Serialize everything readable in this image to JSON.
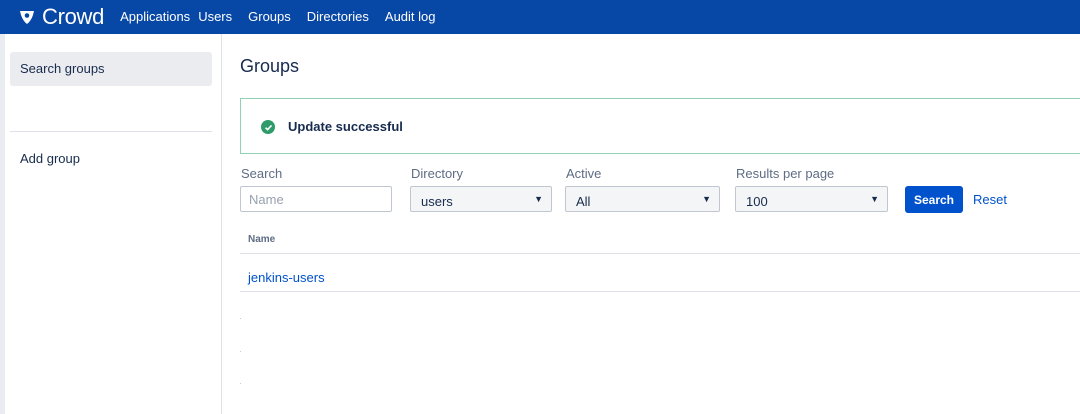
{
  "app": {
    "logo_text": "Crowd"
  },
  "nav": {
    "items": [
      {
        "label": "Applications"
      },
      {
        "label": "Users"
      },
      {
        "label": "Groups"
      },
      {
        "label": "Directories"
      },
      {
        "label": "Audit log"
      }
    ]
  },
  "sidebar": {
    "items": [
      {
        "label": "Search groups",
        "active": true
      },
      {
        "label": "Add group",
        "active": false
      }
    ]
  },
  "main": {
    "title": "Groups",
    "flag": {
      "message": "Update successful",
      "status_color": "#2e9b6a"
    },
    "filters": {
      "search": {
        "label": "Search",
        "placeholder": "Name",
        "value": ""
      },
      "directory": {
        "label": "Directory",
        "value": "users"
      },
      "active": {
        "label": "Active",
        "value": "All"
      },
      "results_per_page": {
        "label": "Results per page",
        "value": "100"
      }
    },
    "search_button": "Search",
    "reset_link": "Reset",
    "table": {
      "columns": [
        "Name"
      ],
      "rows": [
        {
          "name": "jenkins-users"
        }
      ]
    }
  },
  "colors": {
    "nav_bg": "#0747a6",
    "primary": "#0052cc",
    "success": "#2e9b6a"
  }
}
